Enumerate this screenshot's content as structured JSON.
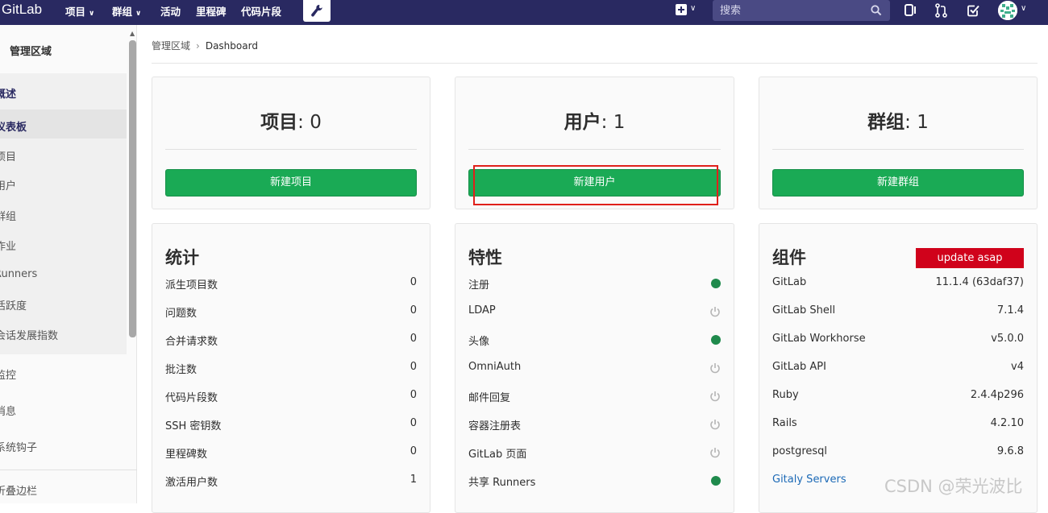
{
  "navbar": {
    "brand": "GitLab",
    "menus": [
      {
        "label": "项目",
        "has_dropdown": true
      },
      {
        "label": "群组",
        "has_dropdown": true
      },
      {
        "label": "活动",
        "has_dropdown": false
      },
      {
        "label": "里程碑",
        "has_dropdown": false
      },
      {
        "label": "代码片段",
        "has_dropdown": false
      }
    ],
    "admin_icon": "wrench-icon",
    "search_placeholder": "搜索",
    "right_icons": [
      "plus-square-icon",
      "sidebar-toggle-icon",
      "merge-request-icon",
      "todo-check-icon",
      "avatar"
    ]
  },
  "sidebar": {
    "title": "管理区域",
    "items": [
      {
        "label": "概述",
        "style": "section"
      },
      {
        "label": "仪表板",
        "style": "active"
      },
      {
        "label": "项目"
      },
      {
        "label": "用户"
      },
      {
        "label": "群组"
      },
      {
        "label": "作业"
      },
      {
        "label": "Runners"
      },
      {
        "label": "活跃度"
      },
      {
        "label": "会话发展指数"
      },
      {
        "label": "监控"
      },
      {
        "label": "消息"
      },
      {
        "label": "系统钩子"
      }
    ],
    "collapse_label": "折叠边栏"
  },
  "breadcrumb": {
    "parent": "管理区域",
    "current": "Dashboard"
  },
  "count_cards": [
    {
      "label": "项目",
      "count": ": 0",
      "button": "新建项目"
    },
    {
      "label": "用户",
      "count": ": 1",
      "button": "新建用户"
    },
    {
      "label": "群组",
      "count": ": 1",
      "button": "新建群组"
    }
  ],
  "stats": {
    "title": "统计",
    "rows": [
      {
        "label": "派生项目数",
        "value": "0"
      },
      {
        "label": "问题数",
        "value": "0"
      },
      {
        "label": "合并请求数",
        "value": "0"
      },
      {
        "label": "批注数",
        "value": "0"
      },
      {
        "label": "代码片段数",
        "value": "0"
      },
      {
        "label": "SSH 密钥数",
        "value": "0"
      },
      {
        "label": "里程碑数",
        "value": "0"
      },
      {
        "label": "激活用户数",
        "value": "1"
      }
    ]
  },
  "features": {
    "title": "特性",
    "rows": [
      {
        "label": "注册",
        "status": "on"
      },
      {
        "label": "LDAP",
        "status": "off"
      },
      {
        "label": "头像",
        "status": "on"
      },
      {
        "label": "OmniAuth",
        "status": "off"
      },
      {
        "label": "邮件回复",
        "status": "off"
      },
      {
        "label": "容器注册表",
        "status": "off"
      },
      {
        "label": "GitLab 页面",
        "status": "off"
      },
      {
        "label": "共享 Runners",
        "status": "on"
      }
    ],
    "colors": {
      "on": "#1f8a4c",
      "off": "#b5b5b5"
    }
  },
  "components": {
    "title": "组件",
    "badge": "update asap",
    "rows": [
      {
        "label": "GitLab",
        "value": "11.1.4 (63daf37)"
      },
      {
        "label": "GitLab Shell",
        "value": "7.1.4"
      },
      {
        "label": "GitLab Workhorse",
        "value": "v5.0.0"
      },
      {
        "label": "GitLab API",
        "value": "v4"
      },
      {
        "label": "Ruby",
        "value": "2.4.4p296"
      },
      {
        "label": "Rails",
        "value": "4.2.10"
      },
      {
        "label": "postgresql",
        "value": "9.6.8"
      }
    ],
    "link": "Gitaly Servers"
  },
  "watermark": "CSDN @荣光波比"
}
